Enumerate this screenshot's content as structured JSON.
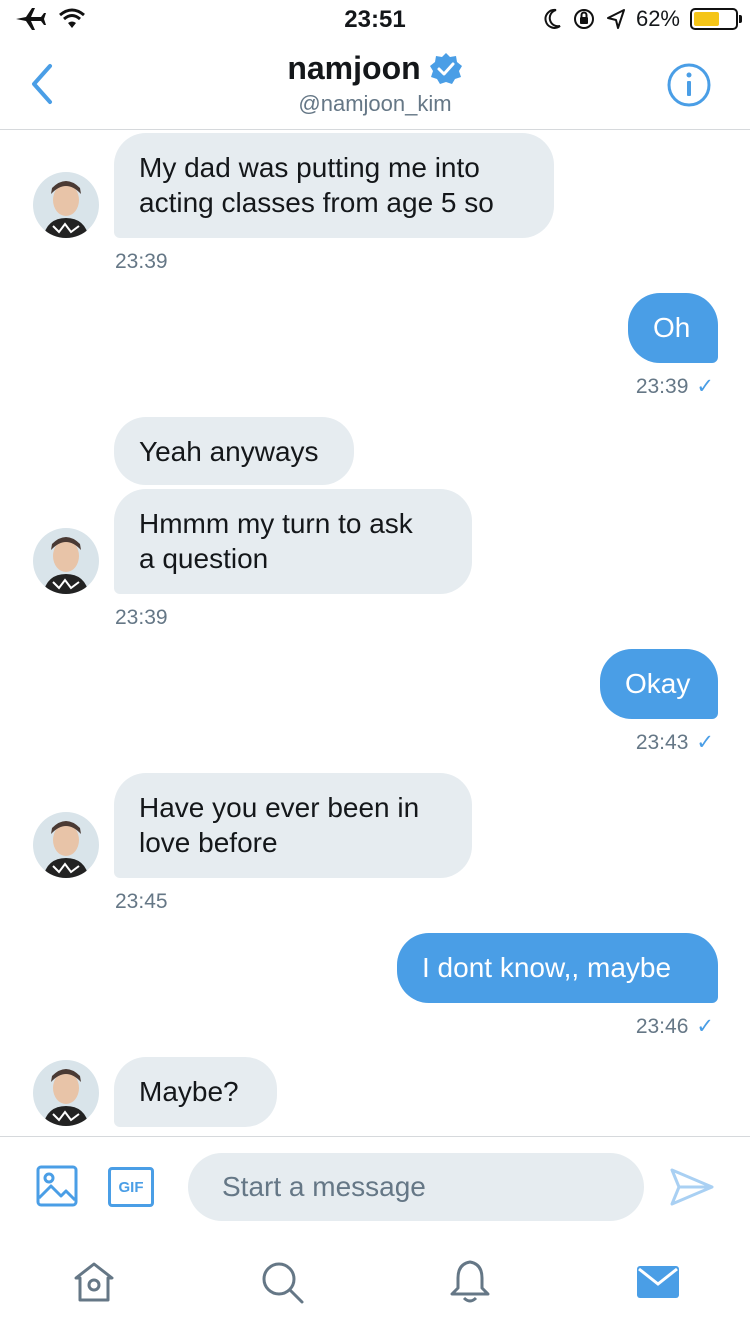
{
  "status_bar": {
    "time": "23:51",
    "battery": "62%"
  },
  "header": {
    "name": "namjoon",
    "handle": "@namjoon_kim"
  },
  "messages": [
    {
      "text_lines": [
        "My dad was putting me into",
        "acting classes from age 5 so"
      ],
      "time": "23:39"
    },
    {
      "text": "Oh",
      "time": "23:39",
      "check": "✓"
    },
    {
      "text": "Yeah anyways"
    },
    {
      "text_lines": [
        "Hmmm my turn to ask",
        "a question"
      ],
      "time": "23:39"
    },
    {
      "text": "Okay",
      "time": "23:43",
      "check": "✓"
    },
    {
      "text_lines": [
        "Have you ever been in",
        "love before"
      ],
      "time": "23:45"
    },
    {
      "text": "I dont know,, maybe",
      "time": "23:46",
      "check": "✓"
    },
    {
      "text": "Maybe?"
    }
  ],
  "composer": {
    "placeholder": "Start a message",
    "gif_label": "GIF"
  },
  "icons": {
    "status": [
      "airplane-icon",
      "wifi-icon",
      "moon-icon",
      "rotation-lock-icon",
      "location-icon",
      "battery-icon"
    ],
    "header": [
      "back-chevron-icon",
      "verified-badge-icon",
      "info-icon"
    ],
    "composer": [
      "image-icon",
      "gif-icon",
      "send-icon"
    ],
    "tabs": [
      "home-icon",
      "search-icon",
      "notifications-bell-icon",
      "messages-envelope-icon"
    ]
  },
  "colors": {
    "accent": "#4a9ee6",
    "incoming_bubble": "#e6ecf0",
    "secondary_text": "#657786",
    "battery_fill": "#f5c518"
  }
}
